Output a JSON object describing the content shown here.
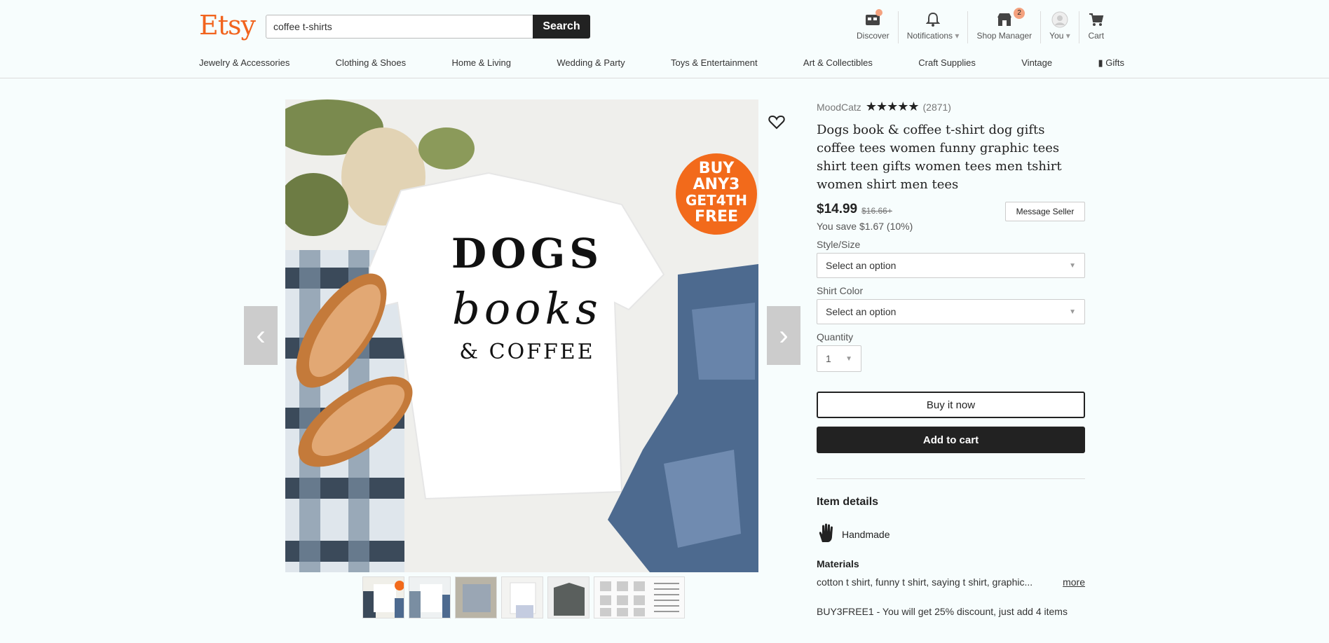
{
  "header": {
    "logo": "Etsy",
    "search_value": "coffee t-shirts",
    "search_button": "Search",
    "nav": [
      {
        "label": "Discover",
        "icon": "discover-icon"
      },
      {
        "label": "Notifications",
        "caret": "▾",
        "icon": "bell-icon"
      },
      {
        "label": "Shop Manager",
        "badge": "2",
        "icon": "shop-icon"
      },
      {
        "label": "You",
        "caret": "▾",
        "icon": "avatar"
      },
      {
        "label": "Cart",
        "icon": "cart-icon"
      }
    ],
    "categories": [
      "Jewelry & Accessories",
      "Clothing & Shoes",
      "Home & Living",
      "Wedding & Party",
      "Toys & Entertainment",
      "Art & Collectibles",
      "Craft Supplies",
      "Vintage",
      "Gifts"
    ]
  },
  "gallery": {
    "shirt_line1": "DOGS",
    "shirt_line2": "books",
    "shirt_line3": "& COFFEE",
    "promo_badge": [
      "BUY",
      "ANY3",
      "GET4TH",
      "FREE"
    ],
    "thumbnail_count": 6
  },
  "listing": {
    "shop_name": "MoodCatz",
    "stars": "★★★★★",
    "review_count": "(2871)",
    "title": "Dogs book & coffee t-shirt dog gifts coffee tees women funny graphic tees shirt teen gifts women tees men tshirt women shirt men tees",
    "price": "$14.99",
    "old_price": "$16.66+",
    "savings": "You save $1.67 (10%)",
    "message_seller": "Message Seller",
    "style_label": "Style/Size",
    "style_value": "Select an option",
    "color_label": "Shirt Color",
    "color_value": "Select an option",
    "qty_label": "Quantity",
    "qty_value": "1",
    "buy_now": "Buy it now",
    "add_to_cart": "Add to cart",
    "details_heading": "Item details",
    "handmade": "Handmade",
    "materials_heading": "Materials",
    "materials_text": "cotton t shirt, funny t shirt, saying t shirt, graphic...",
    "more_link": "more",
    "promo_text": "BUY3FREE1 - You will get 25% discount, just add 4 items"
  },
  "colors": {
    "brand": "#f1641e",
    "dark": "#222222",
    "badge": "#f4a27f"
  }
}
